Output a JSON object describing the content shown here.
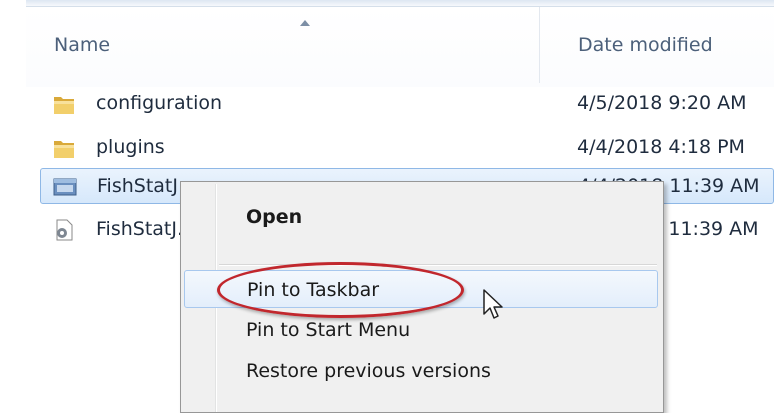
{
  "columns": {
    "name": "Name",
    "date_modified": "Date modified"
  },
  "files": [
    {
      "name": "configuration",
      "date": "4/5/2018 9:20 AM",
      "icon": "folder-icon"
    },
    {
      "name": "plugins",
      "date": "4/4/2018 4:18 PM",
      "icon": "folder-icon"
    },
    {
      "name": "FishStatJ.exe",
      "date": "4/4/2018 11:39 AM",
      "icon": "exe-icon",
      "selected": true
    },
    {
      "name": "FishStatJ.ini",
      "date": "4/4/2018 11:39 AM",
      "icon": "settings-file-icon"
    }
  ],
  "context_menu": {
    "items": [
      {
        "label": "Open",
        "bold": true
      },
      {
        "label": "Pin to Taskbar",
        "hover": true,
        "highlighted": true
      },
      {
        "label": "Pin to Start Menu"
      },
      {
        "label": "Restore previous versions"
      }
    ]
  },
  "colors": {
    "selection": "#d6e8fb",
    "highlight_ring": "#c1272d",
    "folder": "#e8c064"
  }
}
